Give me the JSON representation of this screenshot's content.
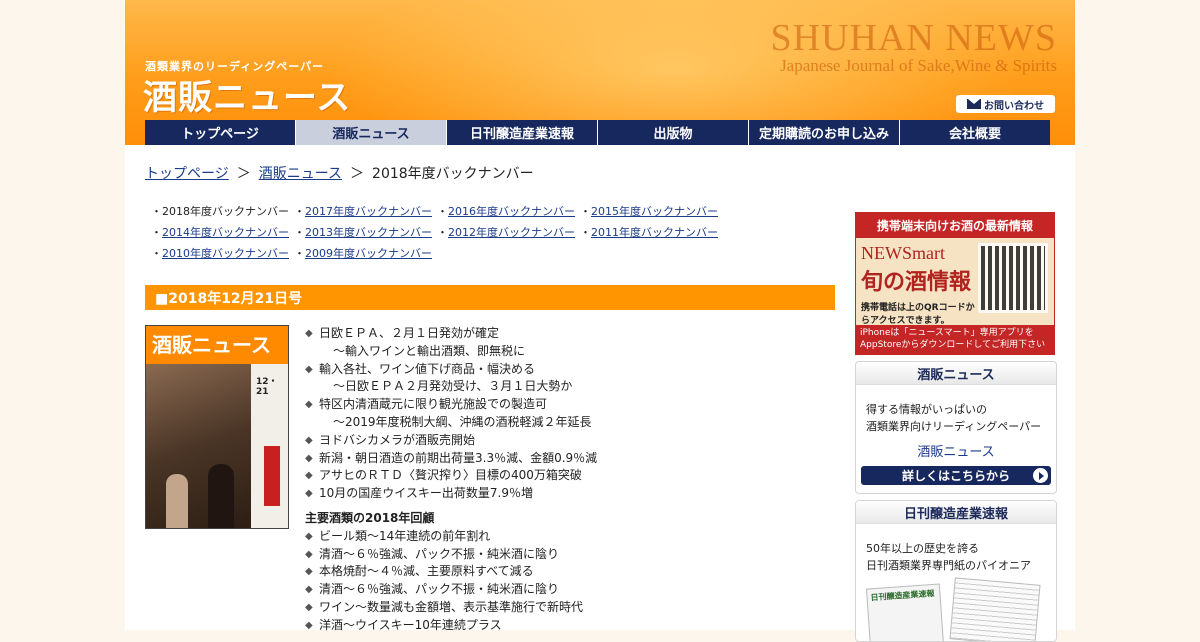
{
  "header": {
    "tagline": "酒類業界のリーディングペーパー",
    "logo": "酒販ニュース",
    "brand_en": "SHUHAN NEWS",
    "brand_sub": "Japanese Journal of Sake,Wine & Spirits",
    "contact_label": "お問い合わせ"
  },
  "nav": [
    {
      "label": "トップページ"
    },
    {
      "label": "酒販ニュース"
    },
    {
      "label": "日刊醸造産業速報"
    },
    {
      "label": "出版物"
    },
    {
      "label": "定期購読のお申し込み"
    },
    {
      "label": "会社概要"
    }
  ],
  "breadcrumb": {
    "home": "トップページ",
    "sep": "＞",
    "section": "酒販ニュース",
    "current": "2018年度バックナンバー"
  },
  "years": [
    [
      "2018年度バックナンバー",
      "2017年度バックナンバー",
      "2016年度バックナンバー",
      "2015年度バックナンバー"
    ],
    [
      "2014年度バックナンバー",
      "2013年度バックナンバー",
      "2012年度バックナンバー",
      "2011年度バックナンバー"
    ],
    [
      "2010年度バックナンバー",
      "2009年度バックナンバー"
    ]
  ],
  "issue": {
    "title": "■2018年12月21日号",
    "cover_title": "酒販ニュース",
    "cover_date": "12・21"
  },
  "headlines": [
    {
      "text": "日欧ＥＰＡ、２月１日発効が確定",
      "sub": "～輸入ワインと輸出酒類、即無税に"
    },
    {
      "text": "輸入各社、ワイン値下げ商品・幅決める",
      "sub": "～日欧ＥＰＡ２月発効受け、３月１日大勢か"
    },
    {
      "text": "特区内清酒蔵元に限り観光施設での製造可",
      "sub": "～2019年度税制大綱、沖縄の酒税軽減２年延長"
    },
    {
      "text": "ヨドバシカメラが酒販売開始",
      "sub": ""
    },
    {
      "text": "新潟・朝日酒造の前期出荷量3.3％減、金額0.9％減",
      "sub": ""
    },
    {
      "text": "アサヒのＲＴＤ〈贅沢搾り〉目標の400万箱突破",
      "sub": ""
    },
    {
      "text": "10月の国産ウイスキー出荷数量7.9％増",
      "sub": ""
    }
  ],
  "section2": {
    "title": "主要酒類の2018年回顧",
    "items": [
      "ビール類～14年連続の前年割れ",
      "清酒～６％強減、パック不振・純米酒に陰り",
      "本格焼酎～４％減、主要原料すべて減る",
      "清酒～６％強減、パック不振・純米酒に陰り",
      "ワイン～数量減も金額増、表示基準施行で新時代",
      "洋酒～ウイスキー10年連続プラス"
    ]
  },
  "sidebar": {
    "app": {
      "top": "携帯端末向けお酒の最新情報",
      "name1": "NEWSmart",
      "name2": "旬の酒情報",
      "qr_note": "携帯電話は上のQRコードからアクセスできます。",
      "foot": "iPhoneは「ニュースマート」専用アプリをAppStoreからダウンロードしてご利用下さい"
    },
    "box1": {
      "title": "酒販ニュース",
      "desc1": "得する情報がいっぱいの",
      "desc2": "酒類業界向けリーディングペーパー",
      "link": "酒販ニュース",
      "button": "詳しくはこちらから"
    },
    "box2": {
      "title": "日刊醸造産業速報",
      "desc1": "50年以上の歴史を誇る",
      "desc2": "日刊酒類業界専門紙のパイオニア",
      "paper_title": "日刊醸造産業速報"
    }
  }
}
